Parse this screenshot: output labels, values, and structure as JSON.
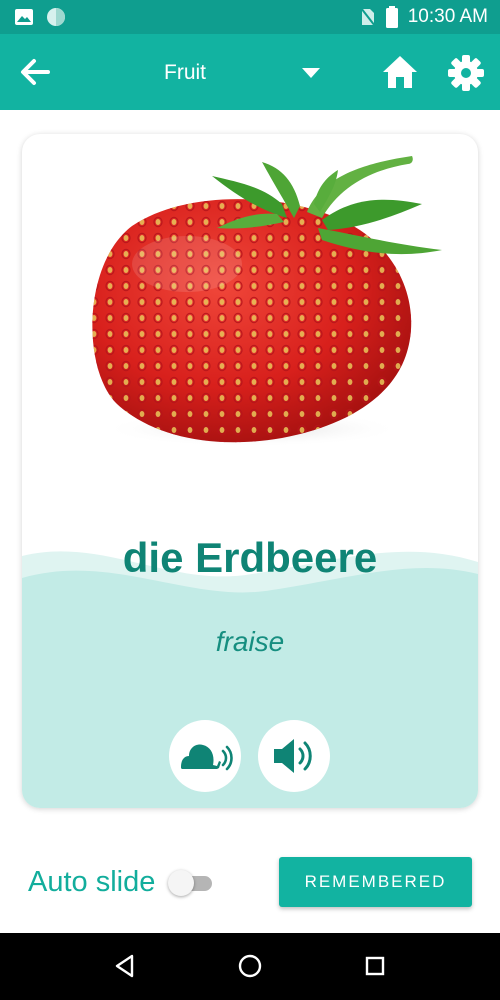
{
  "status_bar": {
    "time": "10:30 AM",
    "icons": [
      "image-icon",
      "circle-icon",
      "no-sim-icon",
      "battery-icon"
    ]
  },
  "app_bar": {
    "category": "Fruit",
    "icons": [
      "back-arrow-icon",
      "dropdown-caret-icon",
      "home-icon",
      "gear-icon"
    ]
  },
  "card": {
    "image": "strawberry-image",
    "word": "die Erdbeere",
    "translation": "fraise",
    "buttons": [
      "snail-sound-icon",
      "speaker-icon"
    ]
  },
  "footer": {
    "auto_slide_label": "Auto slide",
    "auto_slide_on": false,
    "remembered_label": "REMEMBERED"
  },
  "nav_bar": {
    "icons": [
      "back-triangle-icon",
      "home-circle-icon",
      "recents-square-icon"
    ]
  },
  "colors": {
    "primary": "#12b3a1",
    "status_bar": "#0f9e8f",
    "word": "#0f8475",
    "wave": "#c2ebe6"
  }
}
